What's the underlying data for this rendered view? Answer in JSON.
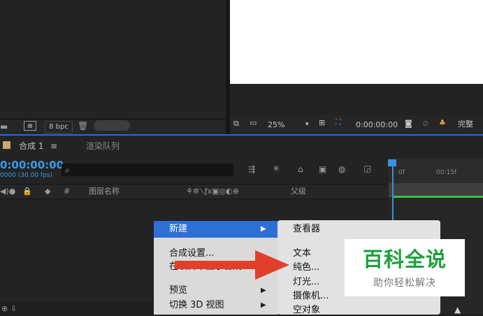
{
  "project_panel": {
    "bpc_label": "8 bpc",
    "icons": [
      "folder-icon",
      "film-icon",
      "trash-icon"
    ]
  },
  "viewer": {
    "zoom": "25%",
    "timecode": "0:00:00:00",
    "quality": "完整"
  },
  "timeline": {
    "tabs": [
      {
        "label": "合成 1",
        "active": true
      },
      {
        "label": "渲染队列",
        "active": false
      }
    ],
    "timecode": "0:00:00:00",
    "fps": "0000 (30.00 fps)",
    "columns": {
      "hash": "#",
      "layer_name": "图层名称",
      "parent": "父级"
    },
    "ruler_labels": [
      "0f",
      "00:15f"
    ]
  },
  "context_menu": {
    "items": [
      {
        "label": "新建",
        "has_submenu": true,
        "highlighted": true
      },
      {
        "label": "合成设置...",
        "has_submenu": false
      },
      {
        "label": "在项目中显示合成",
        "has_submenu": false
      },
      {
        "label": "预览",
        "has_submenu": true
      },
      {
        "label": "切换 3D 视图",
        "has_submenu": true
      }
    ]
  },
  "submenu": {
    "items": [
      {
        "label": "查看器"
      },
      {
        "label": "文本"
      },
      {
        "label": "纯色..."
      },
      {
        "label": "灯光..."
      },
      {
        "label": "摄像机..."
      },
      {
        "label": "空对象"
      }
    ]
  },
  "watermark": {
    "logo": "百科全说",
    "subtitle": "助你轻松解决"
  },
  "colors": {
    "accent": "#2e6fd6",
    "timecode": "#3c9ae8",
    "arrow": "#e0402a",
    "brand": "#1ea03c"
  }
}
